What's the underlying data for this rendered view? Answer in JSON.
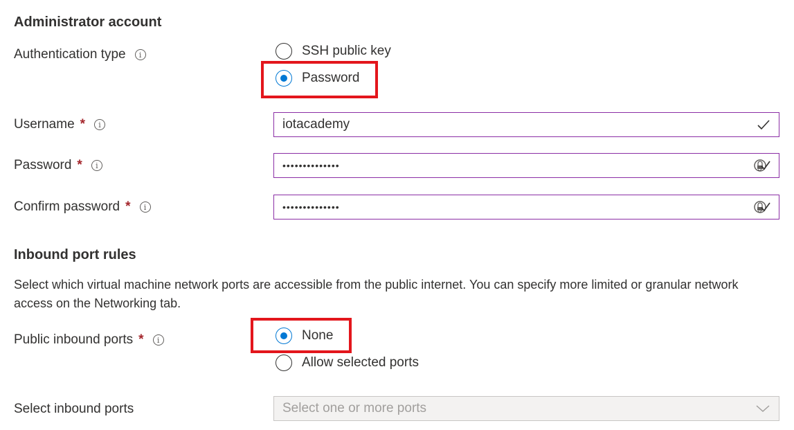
{
  "admin": {
    "title": "Administrator account",
    "auth_label": "Authentication type",
    "auth_options": [
      "SSH public key",
      "Password"
    ],
    "auth_selected": "Password",
    "username_label": "Username",
    "username_value": "iotacademy",
    "password_label": "Password",
    "password_value": "••••••••••••••",
    "confirm_label": "Confirm password",
    "confirm_value": "••••••••••••••",
    "required_mark": "*",
    "info_glyph": "i"
  },
  "inbound": {
    "title": "Inbound port rules",
    "description": "Select which virtual machine network ports are accessible from the public internet. You can specify more limited or granular network access on the Networking tab.",
    "public_label": "Public inbound ports",
    "public_options": [
      "None",
      "Allow selected ports"
    ],
    "public_selected": "None",
    "select_label": "Select inbound ports",
    "select_placeholder": "Select one or more ports"
  },
  "colors": {
    "accent": "#0078d4",
    "highlight": "#e3161c",
    "required": "#a4262c",
    "field_border": "#8a2da5"
  },
  "icons": [
    "info-icon",
    "check-icon",
    "password-reveal-icon",
    "chevron-down-icon"
  ]
}
